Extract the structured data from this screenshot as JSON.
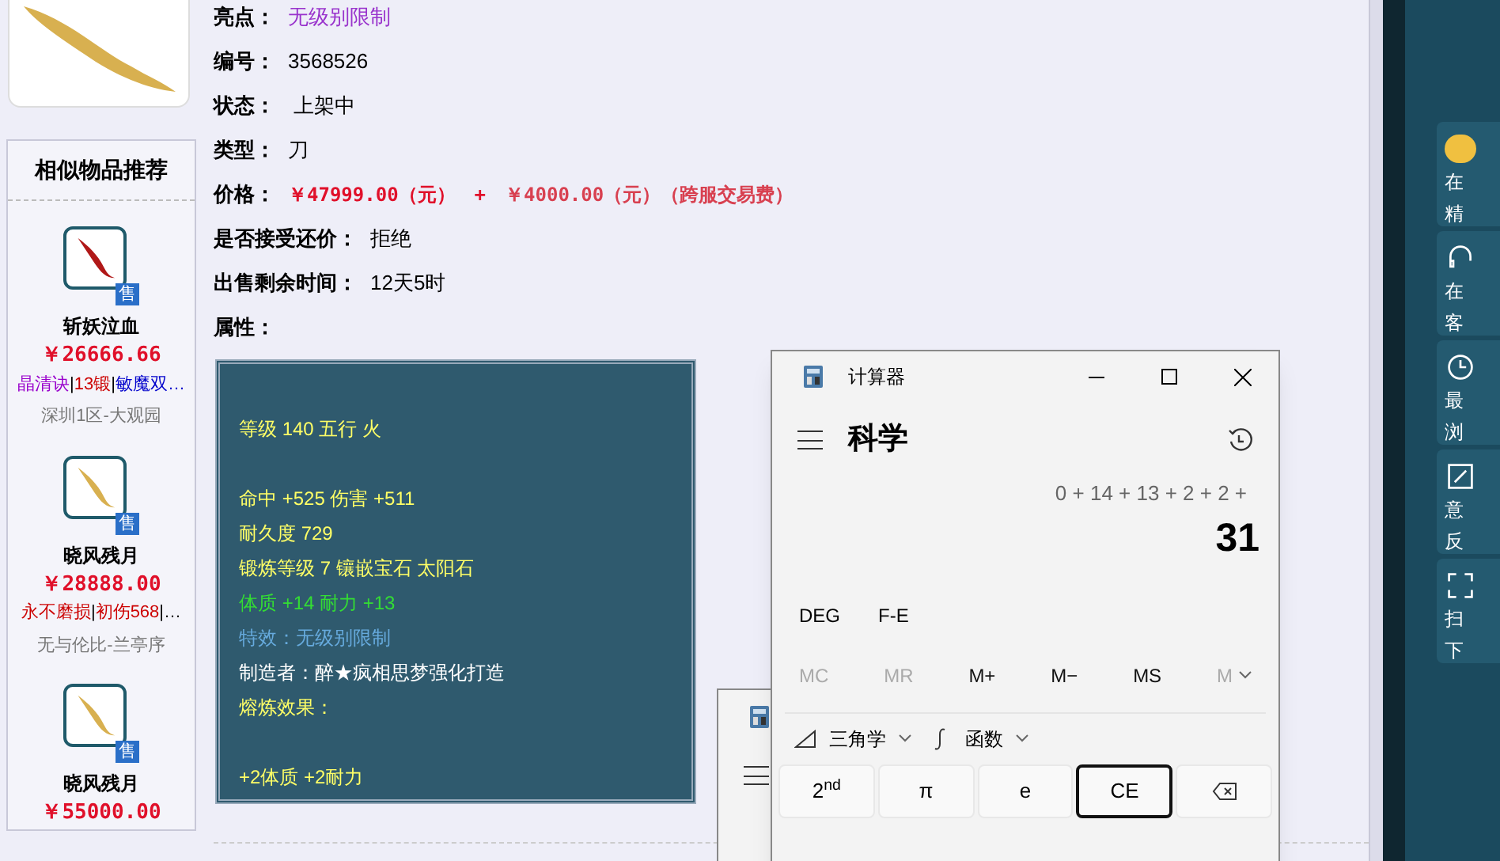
{
  "recommend": {
    "title": "相似物品推荐",
    "items": [
      {
        "name": "斩妖泣血",
        "badge": "售",
        "kind": "blade_red",
        "price": "￥26666.66",
        "tags": [
          {
            "text": "晶清诀",
            "color": "#9900cc"
          },
          {
            "text": "|",
            "color": "#000000"
          },
          {
            "text": "13锻",
            "color": "#cc0000"
          },
          {
            "text": "|",
            "color": "#000000"
          },
          {
            "text": "敏魔双…",
            "color": "#0000cc"
          }
        ],
        "server": "深圳1区-大观园"
      },
      {
        "name": "晓风残月",
        "badge": "售",
        "kind": "blade_gold",
        "price": "￥28888.00",
        "tags": [
          {
            "text": "永不磨损",
            "color": "#cc0000"
          },
          {
            "text": "|",
            "color": "#000000"
          },
          {
            "text": "初伤568",
            "color": "#cc0000"
          },
          {
            "text": "|…",
            "color": "#000000"
          }
        ],
        "server": "无与伦比-兰亭序"
      },
      {
        "name": "晓风残月",
        "badge": "售",
        "kind": "blade_gold",
        "price": "￥55000.00"
      }
    ]
  },
  "details": [
    {
      "kind": "highlight",
      "label": "亮点：",
      "value": "无级别限制"
    },
    {
      "kind": "plain",
      "label": "编号：",
      "value": "3568526"
    },
    {
      "kind": "plain",
      "label": "状态：",
      "value": " 上架中"
    },
    {
      "kind": "plain",
      "label": "类型：",
      "value": "刀"
    },
    {
      "kind": "price",
      "label": "价格：",
      "value": "￥47999.00（元）",
      "plus": "+",
      "fee": "￥4000.00（元）（跨服交易费）"
    },
    {
      "kind": "plain",
      "label": "是否接受还价：",
      "value": "拒绝"
    },
    {
      "kind": "plain",
      "label": "出售剩余时间：",
      "value": "12天5时"
    },
    {
      "kind": "plain",
      "label": "属性："
    }
  ],
  "attribute_groups": [
    [
      {
        "kind": "base",
        "text": "等级 140 五行 火"
      }
    ],
    [
      {
        "kind": "base",
        "text": "命中 +525 伤害 +511"
      },
      {
        "kind": "base",
        "text": "耐久度 729"
      },
      {
        "kind": "base",
        "text": "锻炼等级 7 镶嵌宝石 太阳石"
      },
      {
        "kind": "bonus",
        "text": "体质 +14 耐力 +13"
      },
      {
        "kind": "effect",
        "text": "特效：无级别限制"
      },
      {
        "kind": "maker",
        "text": "制造者：醉★疯相思梦强化打造"
      },
      {
        "kind": "base",
        "text": "熔炼效果："
      }
    ],
    [
      {
        "kind": "base",
        "text": "+2体质 +2耐力"
      }
    ]
  ],
  "calculator": {
    "title": "计算器",
    "mode": "科学",
    "expression": "0 + 14 + 13 + 2 + 2 +",
    "result": "31",
    "modes": [
      "DEG",
      "F-E"
    ],
    "memory": [
      {
        "label": "MC",
        "disabled": true
      },
      {
        "label": "MR",
        "disabled": true
      },
      {
        "label": "M+",
        "disabled": false
      },
      {
        "label": "M−",
        "disabled": false
      },
      {
        "label": "MS",
        "disabled": false
      },
      {
        "label": "M",
        "disabled": true
      }
    ],
    "trig": "三角学",
    "func": "函数",
    "keys": [
      {
        "kind": "text",
        "label": "2$^{nd}$",
        "focused": false
      },
      {
        "kind": "text",
        "label": "π",
        "focused": false
      },
      {
        "kind": "text",
        "label": "e",
        "focused": false
      },
      {
        "kind": "text",
        "label": "CE",
        "focused": true
      },
      {
        "kind": "backspace",
        "focused": false
      }
    ]
  },
  "side_panel": [
    {
      "kind": "avatar",
      "line1": "在",
      "line2": "精"
    },
    {
      "kind": "headset",
      "line1": "在",
      "line2": "客"
    },
    {
      "kind": "clock",
      "line1": "最",
      "line2": "浏"
    },
    {
      "kind": "edit",
      "line1": "意",
      "line2": "反"
    },
    {
      "kind": "scan",
      "line1": "扫",
      "line2": "下"
    }
  ]
}
